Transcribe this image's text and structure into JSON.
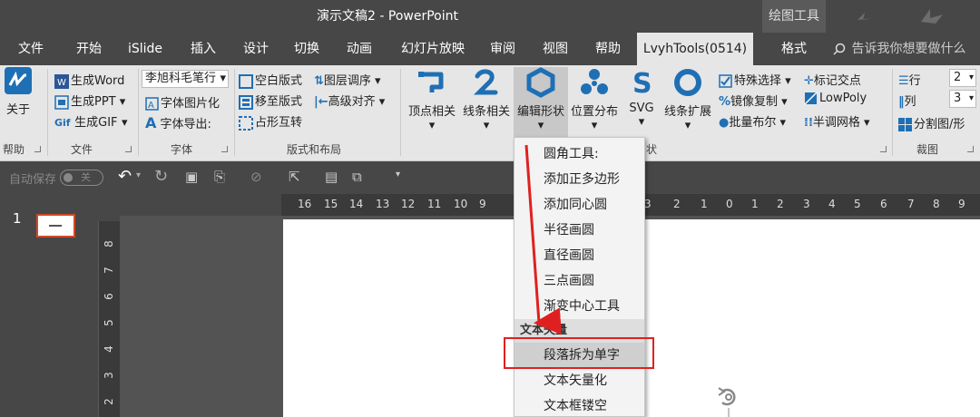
{
  "window": {
    "title": "演示文稿2  -  PowerPoint",
    "context_tab": "绘图工具"
  },
  "tabs": {
    "file": "文件",
    "home": "开始",
    "islide": "iSlide",
    "insert": "插入",
    "design": "设计",
    "transitions": "切换",
    "animations": "动画",
    "slideshow": "幻灯片放映",
    "review": "审阅",
    "view": "视图",
    "help": "帮助",
    "lvyh": "LvyhTools(0514)",
    "format": "格式",
    "search": "告诉我你想要做什么"
  },
  "ribbon": {
    "about": "关于",
    "help_group": "帮助",
    "gen_word": "生成Word",
    "gen_ppt": "生成PPT",
    "gen_gif": "生成GIF",
    "file_group": "文件",
    "font_name": "李旭科毛笔行",
    "text_to_image": "字体图片化",
    "font_export": "字体导出:",
    "font_group": "字体",
    "blank_layout": "空白版式",
    "move_to_layout": "移至版式",
    "placeholder_swap": "占形互转",
    "layer_order": "图层调序",
    "advanced_align": "高级对齐",
    "layout_group": "版式和布局",
    "vertex": "顶点相关",
    "line": "线条相关",
    "edit_shape": "编辑形状",
    "position": "位置分布",
    "svg": "SVG",
    "line_ext": "线条扩展",
    "shape_group_suffix": "状",
    "special_select": "特殊选择",
    "mirror_copy": "镜像复制",
    "batch_boolean": "批量布尔",
    "mark_intersect": "标记交点",
    "lowpoly": "LowPoly",
    "half_grid": "半调网格",
    "rows": "行",
    "cols": "列",
    "rows_val": "2",
    "cols_val": "3",
    "split": "分割图/形",
    "crop_group": "裁图"
  },
  "qat": {
    "autosave": "自动保存",
    "autosave_state": "关"
  },
  "thumbnail": {
    "number": "1"
  },
  "hruler_ticks": [
    "16",
    "15",
    "14",
    "13",
    "12",
    "11",
    "10",
    "9",
    "3",
    "2",
    "1",
    "0",
    "1",
    "2",
    "3",
    "4",
    "5",
    "6",
    "7",
    "8",
    "9"
  ],
  "vruler_ticks": [
    "8",
    "7",
    "6",
    "5",
    "4",
    "3",
    "2"
  ],
  "dropdown": {
    "items": [
      "圆角工具:",
      "添加正多边形",
      "添加同心圆",
      "半径画圆",
      "直径画圆",
      "三点画圆",
      "渐变中心工具"
    ],
    "section": "文本矢量",
    "highlighted": "段落拆为单字",
    "items2": [
      "文本矢量化",
      "文本框镂空"
    ]
  },
  "colors": {
    "accent_red": "#e02020",
    "dark_bg": "#474747",
    "ribbon_bg": "#e6e6e6",
    "icon_blue": "#1f6fb5"
  }
}
